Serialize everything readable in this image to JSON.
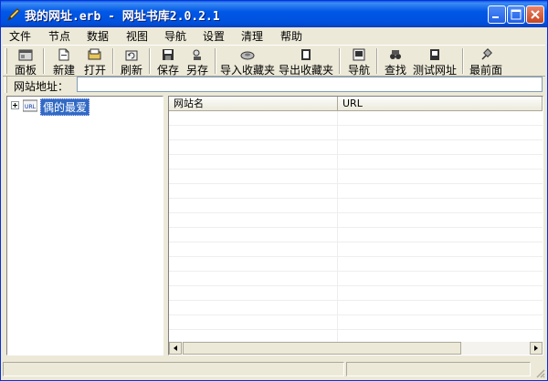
{
  "window": {
    "title": "我的网址.erb - 网址书库2.0.2.1"
  },
  "menu": [
    "文件",
    "节点",
    "数据",
    "视图",
    "导航",
    "设置",
    "清理",
    "帮助"
  ],
  "toolbar": {
    "panel": "面板",
    "new": "新建",
    "open": "打开",
    "refresh": "刷新",
    "save": "保存",
    "save_as": "另存",
    "import_favorites": "导入收藏夹",
    "export_favorites": "导出收藏夹",
    "navigate": "导航",
    "find": "查找",
    "test_url": "测试网址",
    "topmost": "最前面"
  },
  "address": {
    "label": "网站地址：",
    "value": ""
  },
  "tree": {
    "root_label": "偶的最爱",
    "root_icon_text": "URL"
  },
  "list": {
    "columns": [
      "网站名",
      "URL"
    ]
  },
  "colors": {
    "titlebar": "#0058e6",
    "selection": "#316ac5",
    "face": "#ece9d8"
  }
}
